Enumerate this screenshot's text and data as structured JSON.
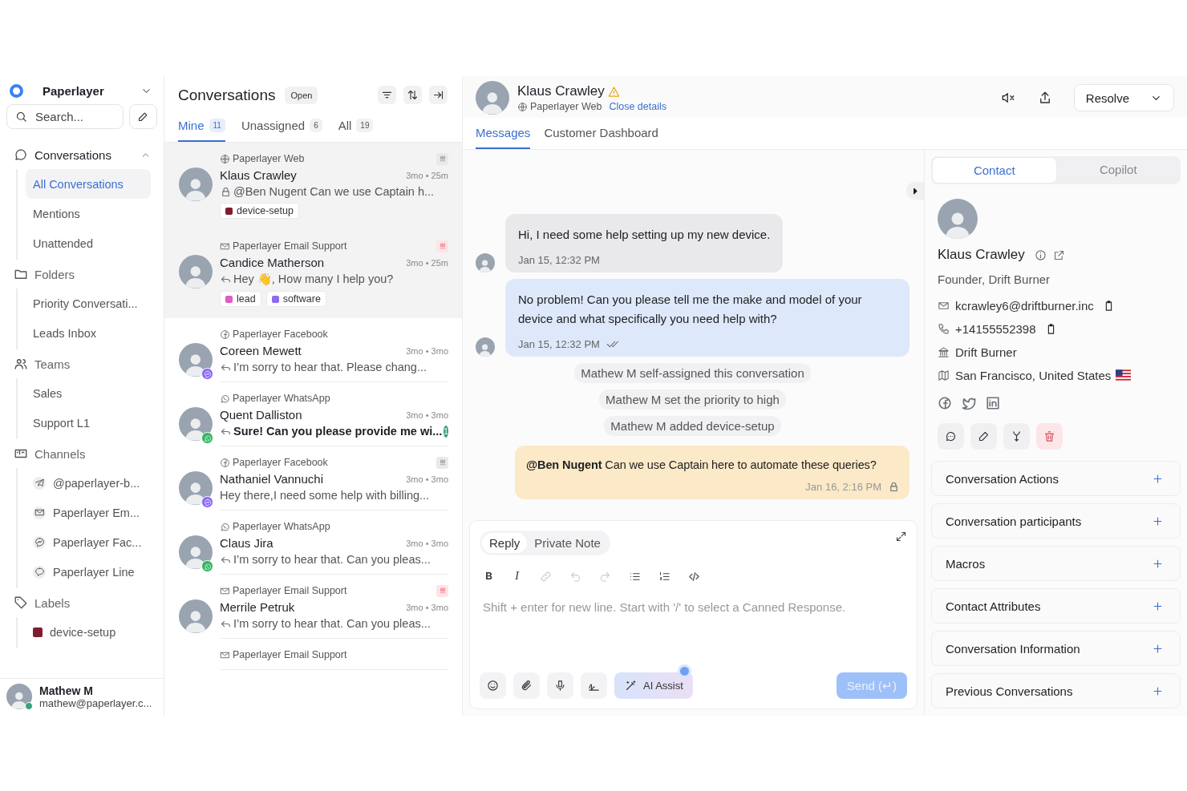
{
  "workspace": {
    "name": "Paperlayer"
  },
  "search": {
    "placeholder": "Search..."
  },
  "nav": [
    {
      "kind": "conversations",
      "label": "Conversations",
      "expanded": true,
      "children": [
        {
          "label": "All Conversations",
          "selected": true
        },
        {
          "label": "Mentions",
          "selected": false
        },
        {
          "label": "Unattended",
          "selected": false
        }
      ]
    },
    {
      "kind": "folders",
      "label": "Folders",
      "children": [
        {
          "label": "Priority Conversati...",
          "selected": false
        },
        {
          "label": "Leads Inbox",
          "selected": false
        }
      ]
    },
    {
      "kind": "teams",
      "label": "Teams",
      "children": [
        {
          "label": "Sales",
          "selected": false
        },
        {
          "label": "Support L1",
          "selected": false
        }
      ]
    },
    {
      "kind": "channels",
      "label": "Channels",
      "children": [
        {
          "kind": "telegram",
          "label": "@paperlayer-b...",
          "selected": false
        },
        {
          "kind": "email",
          "label": "Paperlayer Em...",
          "selected": false
        },
        {
          "kind": "messenger",
          "label": "Paperlayer Fac...",
          "selected": false
        },
        {
          "kind": "line",
          "label": "Paperlayer Line",
          "selected": false
        }
      ]
    },
    {
      "kind": "labels",
      "label": "Labels",
      "children": [
        {
          "kind": "label",
          "label": "device-setup",
          "color": "#7f1d2d",
          "selected": false
        }
      ]
    }
  ],
  "user": {
    "name": "Mathew M",
    "email": "mathew@paperlayer.c...",
    "online": true
  },
  "list": {
    "title": "Conversations",
    "status": "Open",
    "tabs": [
      {
        "label": "Mine",
        "count": "11",
        "selected": true
      },
      {
        "label": "Unassigned",
        "count": "6",
        "selected": false
      },
      {
        "label": "All",
        "count": "19",
        "selected": false
      }
    ],
    "items": [
      {
        "channel": {
          "kind": "web",
          "name": "Paperlayer Web"
        },
        "priority": {
          "kind": "high"
        },
        "name": "Klaus Crawley",
        "time": "3mo • 25m",
        "preview": {
          "kind": "private",
          "text": "@Ben Nugent Can we use Captain h..."
        },
        "labels": [
          {
            "name": "device-setup",
            "color": "#7f1d2d"
          }
        ],
        "selected": true,
        "unread": false
      },
      {
        "channel": {
          "kind": "email",
          "name": "Paperlayer Email Support"
        },
        "priority": {
          "kind": "urgent"
        },
        "name": "Candice Matherson",
        "time": "3mo • 25m",
        "preview": {
          "kind": "reply",
          "text": "Hey 👋, How many I help you?"
        },
        "labels": [
          {
            "name": "lead",
            "color": "#e05cc0"
          },
          {
            "name": "software",
            "color": "#8b6cf0"
          }
        ],
        "selected": true,
        "unread": false
      },
      {
        "channel": {
          "kind": "facebook",
          "name": "Paperlayer Facebook"
        },
        "name": "Coreen Mewett",
        "time": "3mo • 3mo",
        "preview": {
          "kind": "reply",
          "text": "I’m sorry to hear that. Please chang..."
        },
        "badge": {
          "kind": "messenger"
        },
        "selected": false,
        "unread": false
      },
      {
        "channel": {
          "kind": "whatsapp",
          "name": "Paperlayer WhatsApp"
        },
        "name": "Quent Dalliston",
        "time": "3mo • 3mo",
        "preview": {
          "kind": "reply",
          "text": "Sure! Can you please provide me wi..."
        },
        "unread_count": "1",
        "badge": {
          "kind": "whatsapp"
        },
        "selected": false,
        "unread": true
      },
      {
        "channel": {
          "kind": "facebook",
          "name": "Paperlayer Facebook"
        },
        "priority": {
          "kind": "high"
        },
        "name": "Nathaniel Vannuchi",
        "time": "3mo • 3mo",
        "preview": {
          "kind": "incoming",
          "text": "Hey there,I need some help with billing..."
        },
        "badge": {
          "kind": "messenger"
        },
        "selected": false,
        "unread": false
      },
      {
        "channel": {
          "kind": "whatsapp",
          "name": "Paperlayer WhatsApp"
        },
        "name": "Claus Jira",
        "time": "3mo • 3mo",
        "preview": {
          "kind": "reply",
          "text": "I’m sorry to hear that. Can you pleas..."
        },
        "badge": {
          "kind": "whatsapp"
        },
        "selected": false,
        "unread": false
      },
      {
        "channel": {
          "kind": "email",
          "name": "Paperlayer Email Support"
        },
        "priority": {
          "kind": "urgent"
        },
        "name": "Merrile Petruk",
        "time": "3mo • 3mo",
        "preview": {
          "kind": "reply",
          "text": "I’m sorry to hear that. Can you pleas..."
        },
        "selected": false,
        "unread": false
      },
      {
        "channel": {
          "kind": "email",
          "name": "Paperlayer Email Support"
        },
        "selected": false
      }
    ]
  },
  "conversation": {
    "name": "Klaus Crawley",
    "warning": true,
    "channel": {
      "kind": "web",
      "name": "Paperlayer Web"
    },
    "close_link": "Close details",
    "resolve": "Resolve",
    "tabs": [
      {
        "label": "Messages",
        "selected": true
      },
      {
        "label": "Customer Dashboard",
        "selected": false
      }
    ],
    "messages": [
      {
        "kind": "incoming",
        "text": "Hi, I need some help setting up my new device.",
        "time": "Jan 15, 12:32 PM"
      },
      {
        "kind": "outgoing",
        "text": "No problem! Can you please tell me the make and model of your device and what specifically you need help with?",
        "time": "Jan 15, 12:32 PM",
        "read": true
      },
      {
        "kind": "activity",
        "text": "Mathew M self-assigned this conversation"
      },
      {
        "kind": "activity",
        "text": "Mathew M set the priority to high"
      },
      {
        "kind": "activity",
        "text": "Mathew M added device-setup"
      },
      {
        "kind": "private",
        "text": "**@Ben Nugent** Can we use Captain here to automate these queries?",
        "time": "Jan 16, 2:16 PM"
      }
    ],
    "composer": {
      "modes": [
        {
          "label": "Reply",
          "selected": true
        },
        {
          "label": "Private Note",
          "selected": false
        }
      ],
      "toolbar": [
        {
          "kind": "bold",
          "glyph": "B",
          "disabled": false
        },
        {
          "kind": "italic",
          "glyph": "I",
          "disabled": false
        },
        {
          "kind": "link",
          "disabled": true
        },
        {
          "kind": "undo",
          "disabled": true
        },
        {
          "kind": "redo",
          "disabled": true
        },
        {
          "kind": "bullet-list",
          "disabled": false
        },
        {
          "kind": "ordered-list",
          "disabled": false
        },
        {
          "kind": "code",
          "disabled": false
        }
      ],
      "placeholder": "Shift + enter for new line. Start with '/' to select a Canned Response.",
      "ai_assist": "AI Assist",
      "send": "Send (↵)",
      "send_disabled": true
    }
  },
  "details": {
    "tabs": [
      {
        "label": "Contact",
        "selected": true
      },
      {
        "label": "Copilot",
        "selected": false
      }
    ],
    "contact": {
      "name": "Klaus Crawley",
      "title": "Founder, Drift Burner",
      "fields": [
        {
          "kind": "email",
          "value": "kcrawley6@driftburner.inc",
          "copyable": true
        },
        {
          "kind": "phone",
          "value": "+14155552398",
          "copyable": true
        },
        {
          "kind": "company",
          "value": "Drift Burner",
          "copyable": false
        },
        {
          "kind": "location",
          "value": "San Francisco, United States",
          "copyable": false
        }
      ],
      "social": [
        {
          "kind": "facebook"
        },
        {
          "kind": "twitter"
        },
        {
          "kind": "linkedin"
        }
      ]
    },
    "actions": [
      {
        "kind": "message"
      },
      {
        "kind": "edit"
      },
      {
        "kind": "merge"
      },
      {
        "kind": "delete"
      }
    ],
    "sections": [
      {
        "title": "Conversation Actions",
        "expanded": false
      },
      {
        "title": "Conversation participants",
        "expanded": false
      },
      {
        "title": "Macros",
        "expanded": false
      },
      {
        "title": "Contact Attributes",
        "expanded": false
      },
      {
        "title": "Conversation Information",
        "expanded": false
      },
      {
        "title": "Previous Conversations",
        "expanded": false
      }
    ]
  }
}
